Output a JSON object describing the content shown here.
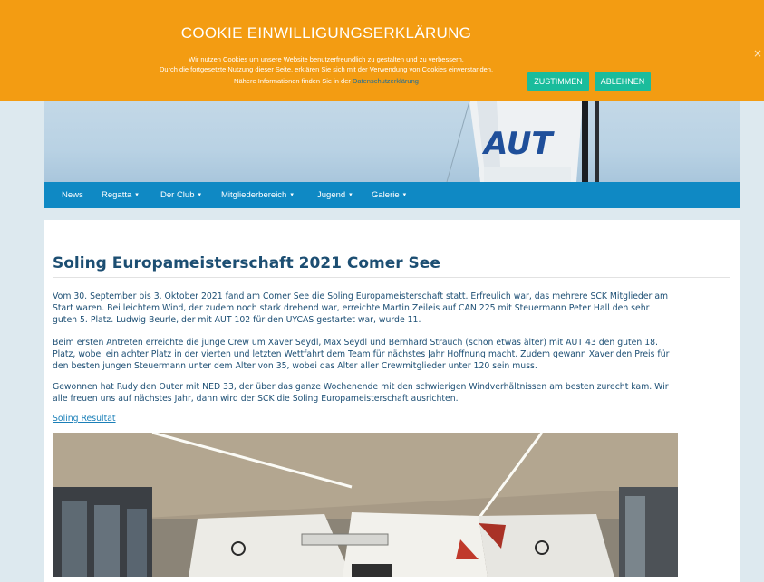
{
  "cookie": {
    "title": "COOKIE EINWILLIGUNGSERKLÄRUNG",
    "line1": "Wir nutzen Cookies um unsere Website benutzerfreundlich zu gestalten und zu verbessern.",
    "line2": "Durch die fortgesetzte Nutzung dieser Seite, erklären Sie sich mit der Verwendung von Cookies einverstanden.",
    "line3_prefix": "Nähere Informationen finden Sie in der ",
    "line3_link": "Datenschutzerklärung",
    "accept_label": "ZUSTIMMEN",
    "reject_label": "ABLEHNEN",
    "close_symbol": "×",
    "background_color": "#f39c12",
    "button_color": "#1abc9c"
  },
  "hero": {
    "sail_text": "AUT"
  },
  "nav": {
    "background_color": "#0f89c4",
    "items": [
      {
        "label": "News",
        "has_dropdown": false
      },
      {
        "label": "Regatta",
        "has_dropdown": true
      },
      {
        "label": "Der Club",
        "has_dropdown": true
      },
      {
        "label": "Mitgliederbereich",
        "has_dropdown": true
      },
      {
        "label": "Jugend",
        "has_dropdown": true
      },
      {
        "label": "Galerie",
        "has_dropdown": true
      }
    ],
    "caret_symbol": "▾"
  },
  "article": {
    "title": "Soling Europameisterschaft 2021 Comer See",
    "paragraph1": [
      "Vom 30. September bis 3. Oktober 2021 fand am Comer See die Soling Europameisterschaft statt. Erfreulich war, das mehrere SCK Mitglieder am",
      "Start waren. Bei leichtem Wind, der zudem noch stark drehend war, erreichte Martin Zeileis auf CAN 225 mit Steuermann Peter Hall den sehr",
      "guten 5. Platz. Ludwig Beurle, der mit AUT 102 für den UYCAS gestartet war, wurde 11."
    ],
    "paragraph2": [
      "Beim ersten Antreten erreichte die junge Crew um Xaver Seydl, Max Seydl und Bernhard Strauch (schon etwas älter) mit AUT 43 den guten 18.",
      "Platz, wobei ein achter Platz in der vierten und letzten Wettfahrt dem Team für nächstes Jahr Hoffnung macht. Zudem gewann Xaver den Preis für",
      "den besten jungen Steuermann unter dem Alter von 35, wobei das Alter aller Crewmitglieder unter 120 sein muss."
    ],
    "paragraph3": [
      "Gewonnen hat Rudy den Outer mit NED 33, der über das ganze Wochenende mit den schwierigen Windverhältnissen am besten zurecht kam. Wir",
      "alle freuen uns auf nächstes Jahr, dann wird der SCK die Soling Europameisterschaft ausrichten."
    ],
    "result_link": "Soling Resultat",
    "text_color": "#1d4f74",
    "title_color": "#1c4e72"
  }
}
